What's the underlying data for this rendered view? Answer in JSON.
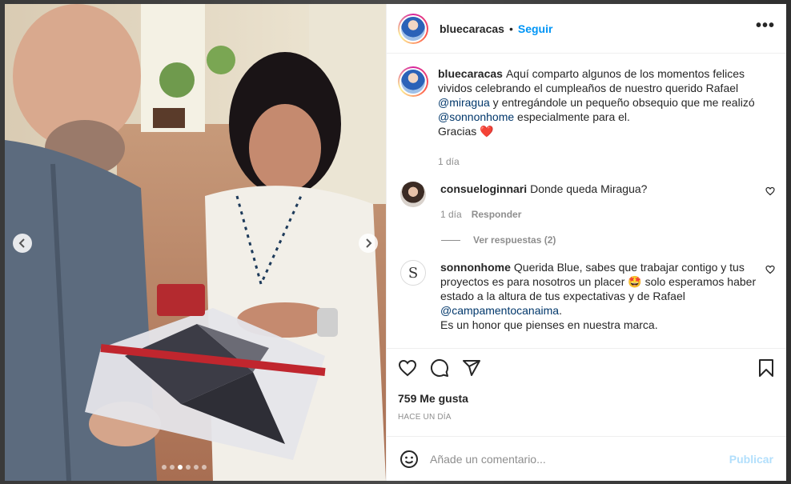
{
  "post": {
    "username": "bluecaracas",
    "separator": "•",
    "follow_label": "Seguir",
    "more_label": "•••"
  },
  "caption": {
    "username": "bluecaracas",
    "text_1": "Aquí comparto algunos de los momentos felices vividos celebrando el cumpleaños de nuestro querido Rafael ",
    "mention_1": "@miragua",
    "text_2": " y entregándole un pequeño obsequio que me realizó ",
    "mention_2": "@sonnonhome",
    "text_3": " especialmente para el.",
    "text_4": "Gracias",
    "heart_emoji": "❤️",
    "time": "1 día"
  },
  "comments": [
    {
      "username": "consueloginnari",
      "text": "Donde queda Miragua?",
      "time": "1 día",
      "reply_label": "Responder",
      "view_replies": "Ver respuestas (2)"
    },
    {
      "username": "sonnonhome",
      "avatar_letter": "S",
      "text_1": "Querida Blue, sabes que trabajar contigo y tus proyectos es para nosotros un placer ",
      "emoji": "🤩",
      "text_2": " solo esperamos haber estado a la altura de tus expectativas y de Rafael ",
      "mention": "@campamentocanaima",
      "text_3": "Es un honor que pienses en nuestra marca."
    }
  ],
  "stats": {
    "likes": "759 Me gusta",
    "posted": "HACE UN DÍA"
  },
  "composer": {
    "placeholder": "Añade un comentario...",
    "publish_label": "Publicar"
  },
  "carousel": {
    "total_slides": 6,
    "active_slide": 3
  },
  "colors": {
    "accent": "#0095f6",
    "mention": "#00376b",
    "publish_disabled": "#b2dffc"
  }
}
